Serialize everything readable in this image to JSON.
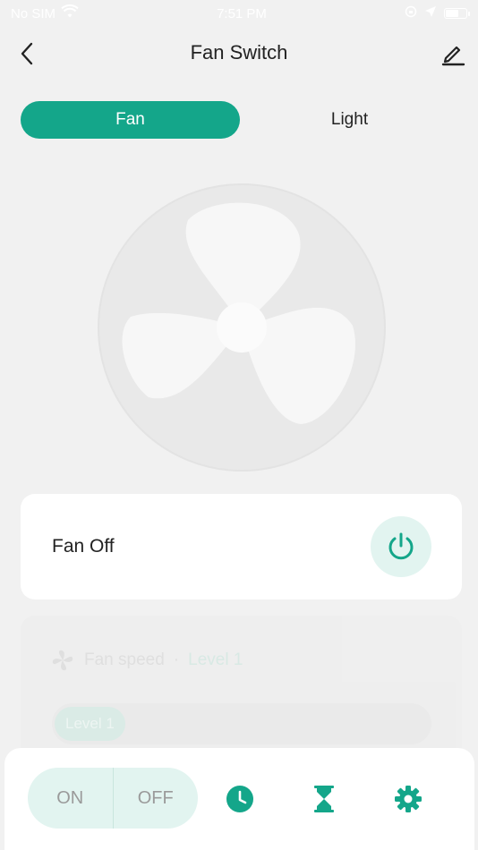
{
  "status_bar": {
    "carrier": "No SIM",
    "time": "7:51 PM"
  },
  "header": {
    "title": "Fan Switch",
    "back_icon": "chevron-left-icon",
    "edit_icon": "pencil-icon"
  },
  "tabs": [
    {
      "label": "Fan",
      "active": true
    },
    {
      "label": "Light",
      "active": false
    }
  ],
  "colors": {
    "accent": "#14a68a",
    "accent_light": "#e2f4f0",
    "background": "#f1f1f1"
  },
  "status_card": {
    "label": "Fan Off",
    "icon": "power-icon"
  },
  "speed_card": {
    "title": "Fan speed",
    "separator": "·",
    "value": "Level 1",
    "pill_label": "Level 1",
    "icon": "fan-icon"
  },
  "bottom_bar": {
    "on_label": "ON",
    "off_label": "OFF",
    "icons": [
      "clock-icon",
      "hourglass-icon",
      "settings-gear-icon"
    ]
  }
}
